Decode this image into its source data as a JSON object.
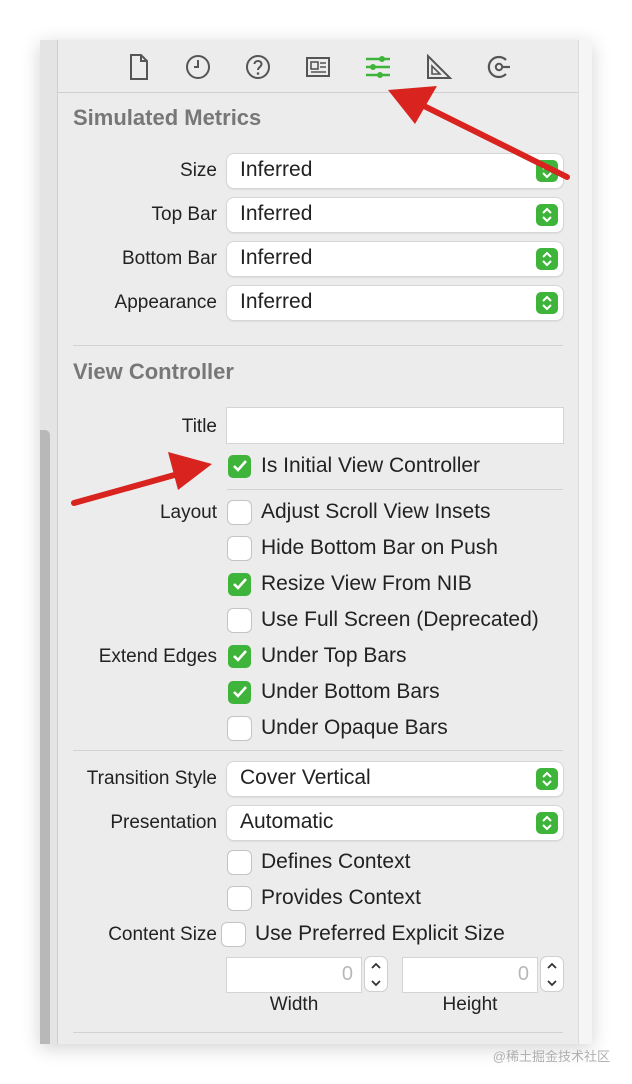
{
  "toolbar": {
    "icons": [
      "file-inspector-icon",
      "history-inspector-icon",
      "quick-help-icon",
      "identity-inspector-icon",
      "attributes-inspector-icon",
      "size-inspector-icon",
      "connections-inspector-icon"
    ],
    "active": "attributes-inspector-icon",
    "accent_color": "#3fb43a"
  },
  "simulated_metrics": {
    "title": "Simulated Metrics",
    "rows": [
      {
        "label": "Size",
        "value": "Inferred"
      },
      {
        "label": "Top Bar",
        "value": "Inferred"
      },
      {
        "label": "Bottom Bar",
        "value": "Inferred"
      },
      {
        "label": "Appearance",
        "value": "Inferred"
      }
    ]
  },
  "view_controller": {
    "title": "View Controller",
    "title_field": {
      "label": "Title",
      "value": ""
    },
    "initial": {
      "label": "Is Initial View Controller",
      "checked": true
    },
    "layout": {
      "label": "Layout",
      "options": [
        {
          "label": "Adjust Scroll View Insets",
          "checked": false
        },
        {
          "label": "Hide Bottom Bar on Push",
          "checked": false
        },
        {
          "label": "Resize View From NIB",
          "checked": true
        },
        {
          "label": "Use Full Screen (Deprecated)",
          "checked": false
        }
      ]
    },
    "extend_edges": {
      "label": "Extend Edges",
      "options": [
        {
          "label": "Under Top Bars",
          "checked": true
        },
        {
          "label": "Under Bottom Bars",
          "checked": true
        },
        {
          "label": "Under Opaque Bars",
          "checked": false
        }
      ]
    },
    "transition_style": {
      "label": "Transition Style",
      "value": "Cover Vertical"
    },
    "presentation": {
      "label": "Presentation",
      "value": "Automatic"
    },
    "context": [
      {
        "label": "Defines Context",
        "checked": false
      },
      {
        "label": "Provides Context",
        "checked": false
      }
    ],
    "content_size": {
      "label": "Content Size",
      "option": {
        "label": "Use Preferred Explicit Size",
        "checked": false
      },
      "width": {
        "value": "0",
        "label": "Width"
      },
      "height": {
        "value": "0",
        "label": "Height"
      }
    }
  },
  "annotation_color": "#d9231f",
  "watermark": "@稀土掘金技术社区"
}
